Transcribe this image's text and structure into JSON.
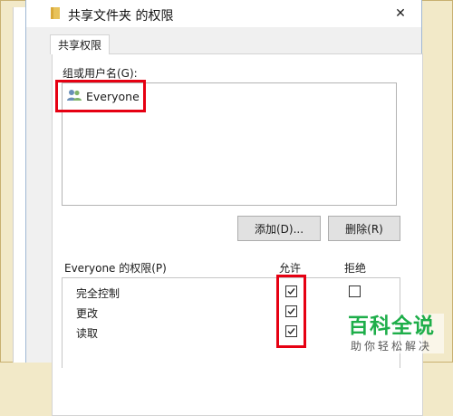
{
  "window": {
    "title": "共享文件夹 的权限",
    "close_glyph": "✕"
  },
  "tabs": [
    {
      "label": "共享权限",
      "active": true
    }
  ],
  "groups_section": {
    "label": "组或用户名(G):",
    "items": [
      {
        "name": "Everyone",
        "icon": "users-icon",
        "selected": false
      }
    ]
  },
  "buttons": {
    "add_label": "添加(D)...",
    "remove_label": "删除(R)"
  },
  "permissions": {
    "header_label": "Everyone 的权限(P)",
    "allow_header": "允许",
    "deny_header": "拒绝",
    "rows": [
      {
        "name": "完全控制",
        "allow": true,
        "deny": false
      },
      {
        "name": "更改",
        "allow": true,
        "deny": false
      },
      {
        "name": "读取",
        "allow": true,
        "deny": false
      }
    ]
  },
  "watermark": {
    "main": "百科全说",
    "sub": "助你轻松解决"
  },
  "colors": {
    "highlight_red": "#e60012",
    "watermark_green": "#1eae4a",
    "background_tan": "#f2e9c8"
  }
}
